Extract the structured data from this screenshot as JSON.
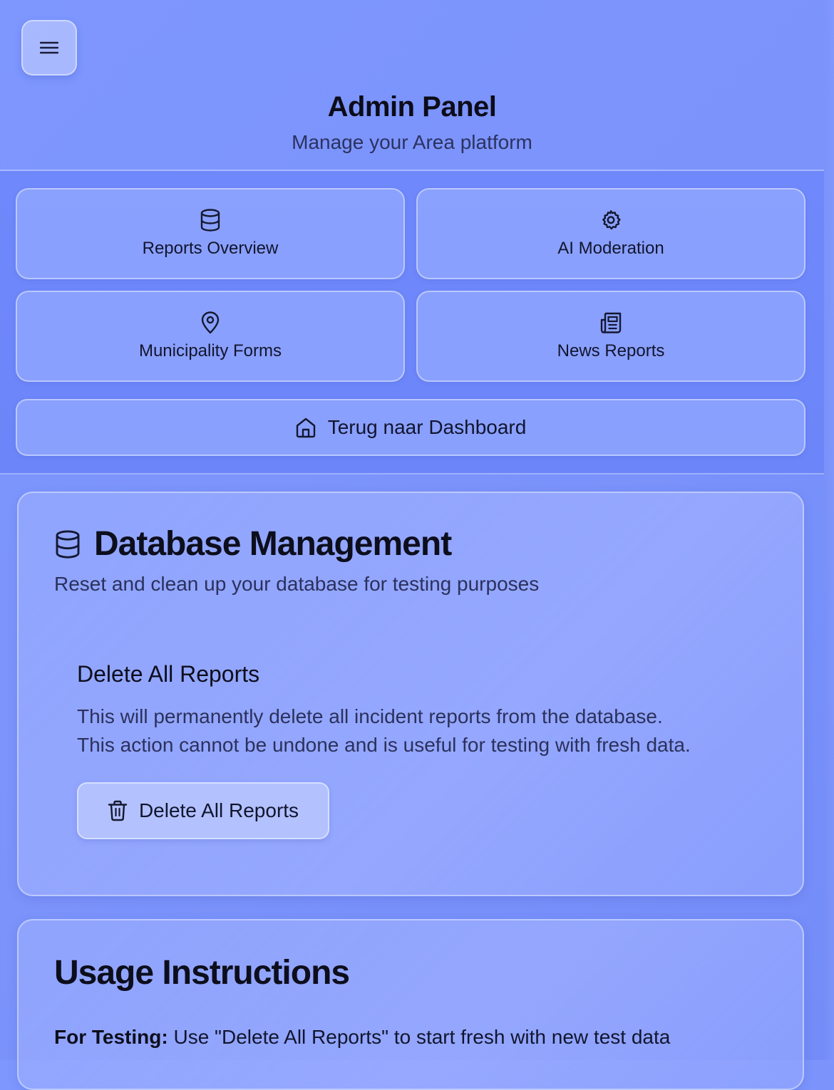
{
  "header": {
    "title": "Admin Panel",
    "subtitle": "Manage your Area platform",
    "menu_icon": "hamburger-menu-icon"
  },
  "nav": {
    "items": [
      {
        "label": "Reports Overview",
        "icon": "database-icon"
      },
      {
        "label": "AI Moderation",
        "icon": "gear-icon"
      },
      {
        "label": "Municipality Forms",
        "icon": "map-pin-icon"
      },
      {
        "label": "News Reports",
        "icon": "newspaper-icon"
      }
    ],
    "dashboard": {
      "label": "Terug naar Dashboard",
      "icon": "home-icon"
    }
  },
  "database_management": {
    "title": "Database Management",
    "description": "Reset and clean up your database for testing purposes",
    "delete_section": {
      "title": "Delete All Reports",
      "text_line1": "This will permanently delete all incident reports from the database.",
      "text_line2": "This action cannot be undone and is useful for testing with fresh data.",
      "button_label": "Delete All Reports",
      "button_icon": "trash-icon"
    }
  },
  "usage": {
    "title": "Usage Instructions",
    "line_label": "For Testing:",
    "line_text": "Use \"Delete All Reports\" to start fresh with new test data"
  },
  "colors": {
    "background": "#7b93fb",
    "nav_background": "#6f88fb",
    "text_primary": "#0d0e1c",
    "text_secondary": "#2b315c"
  }
}
